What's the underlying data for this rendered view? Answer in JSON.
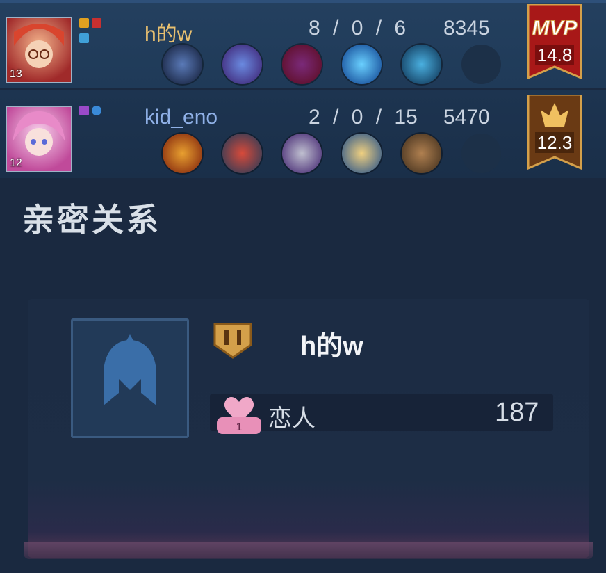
{
  "players": [
    {
      "name": "h的w",
      "level": "13",
      "kda": "8 / 0 / 6",
      "score": "8345",
      "badge_title": "MVP",
      "rating": "14.8",
      "items": [
        "boots-item",
        "dragon-staff-item",
        "dark-hat-item",
        "blue-orb-item",
        "frost-mask-item",
        "empty-slot"
      ]
    },
    {
      "name": "kid_eno",
      "level": "12",
      "kda": "2 / 0 / 15",
      "score": "5470",
      "rating": "12.3",
      "items": [
        "fire-flower-item",
        "red-boots-item",
        "armor-gauntlet-item",
        "hourglass-item",
        "tome-item",
        "empty-slot"
      ]
    }
  ],
  "section": {
    "title": "亲密关系"
  },
  "relationship": {
    "partner_name": "h的w",
    "type": "恋人",
    "heart_level": "1",
    "value": "187"
  },
  "colors": {
    "mvp_red": "#a81818",
    "gold": "#d4a04a",
    "name_gold": "#e8c070",
    "name_blue": "#8fb0e6"
  }
}
